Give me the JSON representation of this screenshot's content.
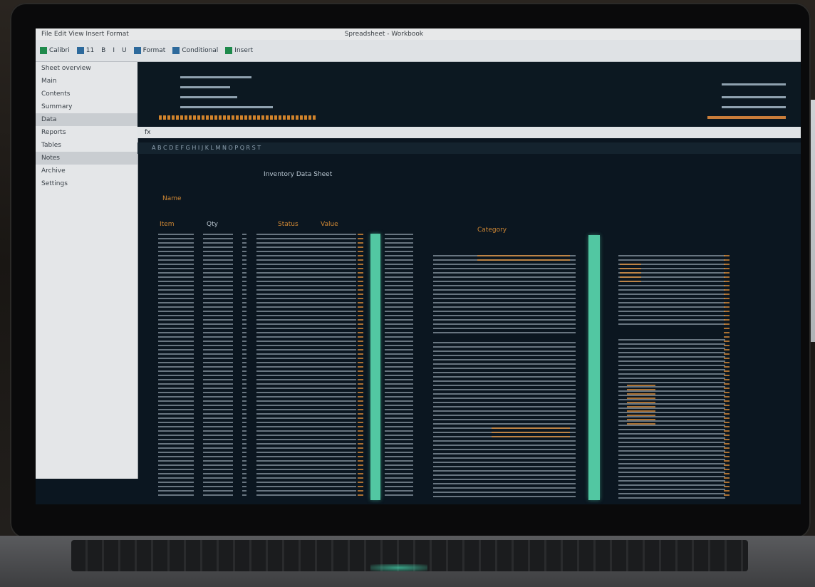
{
  "app": {
    "title_left": "File Edit View Insert Format",
    "title_center": "Spreadsheet - Workbook",
    "ribbon_items": [
      "Calibri",
      "11",
      "B",
      "I",
      "U",
      "Format",
      "Conditional",
      "Insert"
    ],
    "formula_bar_text": "fx",
    "column_strip": "A   B   C   D   E   F   G   H   I   J   K   L   M   N   O   P   Q   R   S   T"
  },
  "sidebar": {
    "items": [
      "Sheet overview",
      "Main",
      "Contents",
      "Summary",
      "Data",
      "Reports",
      "Tables",
      "Notes",
      "Archive",
      "Settings"
    ]
  },
  "sheet": {
    "title": "Inventory Data Sheet",
    "headers": [
      "Name",
      "Item",
      "Qty",
      "Status",
      "Value",
      "Category"
    ]
  },
  "colors": {
    "teal_accent": "#52c7a2",
    "orange_accent": "#d0832c",
    "screen_bg": "#0b1620"
  }
}
